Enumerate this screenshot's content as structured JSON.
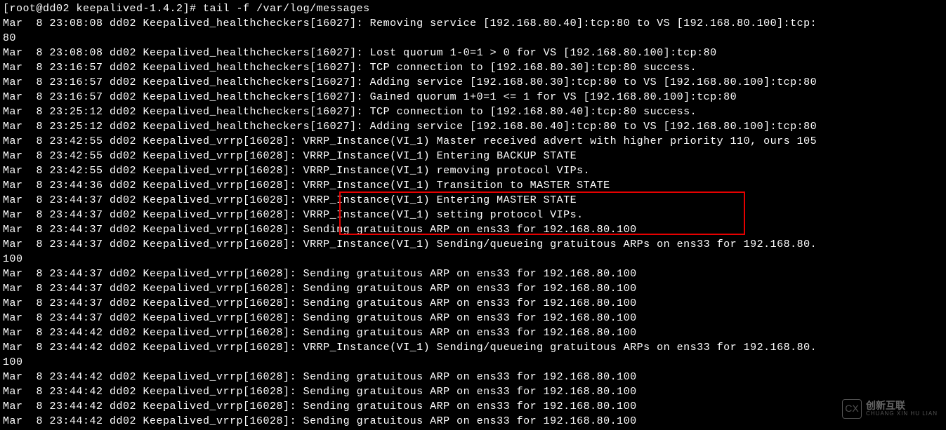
{
  "terminal": {
    "prompt": "[root@dd02 keepalived-1.4.2]# tail -f /var/log/messages",
    "lines": [
      "Mar  8 23:08:08 dd02 Keepalived_healthcheckers[16027]: Removing service [192.168.80.40]:tcp:80 to VS [192.168.80.100]:tcp:",
      "80",
      "Mar  8 23:08:08 dd02 Keepalived_healthcheckers[16027]: Lost quorum 1-0=1 > 0 for VS [192.168.80.100]:tcp:80",
      "Mar  8 23:16:57 dd02 Keepalived_healthcheckers[16027]: TCP connection to [192.168.80.30]:tcp:80 success.",
      "Mar  8 23:16:57 dd02 Keepalived_healthcheckers[16027]: Adding service [192.168.80.30]:tcp:80 to VS [192.168.80.100]:tcp:80",
      "Mar  8 23:16:57 dd02 Keepalived_healthcheckers[16027]: Gained quorum 1+0=1 <= 1 for VS [192.168.80.100]:tcp:80",
      "Mar  8 23:25:12 dd02 Keepalived_healthcheckers[16027]: TCP connection to [192.168.80.40]:tcp:80 success.",
      "Mar  8 23:25:12 dd02 Keepalived_healthcheckers[16027]: Adding service [192.168.80.40]:tcp:80 to VS [192.168.80.100]:tcp:80",
      "Mar  8 23:42:55 dd02 Keepalived_vrrp[16028]: VRRP_Instance(VI_1) Master received advert with higher priority 110, ours 105",
      "Mar  8 23:42:55 dd02 Keepalived_vrrp[16028]: VRRP_Instance(VI_1) Entering BACKUP STATE",
      "Mar  8 23:42:55 dd02 Keepalived_vrrp[16028]: VRRP_Instance(VI_1) removing protocol VIPs.",
      "Mar  8 23:44:36 dd02 Keepalived_vrrp[16028]: VRRP_Instance(VI_1) Transition to MASTER STATE",
      "Mar  8 23:44:37 dd02 Keepalived_vrrp[16028]: VRRP_Instance(VI_1) Entering MASTER STATE",
      "Mar  8 23:44:37 dd02 Keepalived_vrrp[16028]: VRRP_Instance(VI_1) setting protocol VIPs.",
      "Mar  8 23:44:37 dd02 Keepalived_vrrp[16028]: Sending gratuitous ARP on ens33 for 192.168.80.100",
      "Mar  8 23:44:37 dd02 Keepalived_vrrp[16028]: VRRP_Instance(VI_1) Sending/queueing gratuitous ARPs on ens33 for 192.168.80.",
      "100",
      "Mar  8 23:44:37 dd02 Keepalived_vrrp[16028]: Sending gratuitous ARP on ens33 for 192.168.80.100",
      "Mar  8 23:44:37 dd02 Keepalived_vrrp[16028]: Sending gratuitous ARP on ens33 for 192.168.80.100",
      "Mar  8 23:44:37 dd02 Keepalived_vrrp[16028]: Sending gratuitous ARP on ens33 for 192.168.80.100",
      "Mar  8 23:44:37 dd02 Keepalived_vrrp[16028]: Sending gratuitous ARP on ens33 for 192.168.80.100",
      "Mar  8 23:44:42 dd02 Keepalived_vrrp[16028]: Sending gratuitous ARP on ens33 for 192.168.80.100",
      "Mar  8 23:44:42 dd02 Keepalived_vrrp[16028]: VRRP_Instance(VI_1) Sending/queueing gratuitous ARPs on ens33 for 192.168.80.",
      "100",
      "Mar  8 23:44:42 dd02 Keepalived_vrrp[16028]: Sending gratuitous ARP on ens33 for 192.168.80.100",
      "Mar  8 23:44:42 dd02 Keepalived_vrrp[16028]: Sending gratuitous ARP on ens33 for 192.168.80.100",
      "Mar  8 23:44:42 dd02 Keepalived_vrrp[16028]: Sending gratuitous ARP on ens33 for 192.168.80.100",
      "Mar  8 23:44:42 dd02 Keepalived_vrrp[16028]: Sending gratuitous ARP on ens33 for 192.168.80.100"
    ]
  },
  "watermark": {
    "icon": "CX",
    "main": "创新互联",
    "sub": "CHUANG XIN HU LIAN"
  }
}
